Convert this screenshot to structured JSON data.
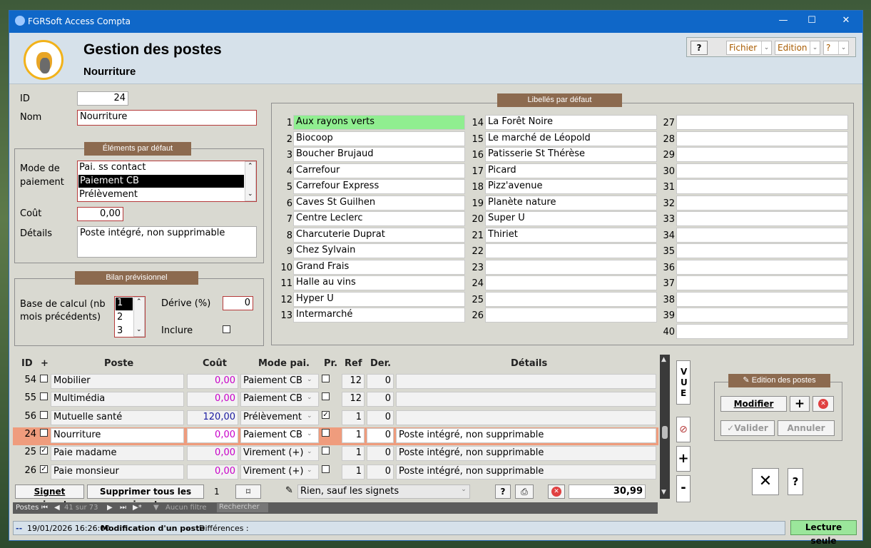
{
  "window": {
    "title": "FGRSoft Access Compta",
    "minimize": "—",
    "maximize": "☐",
    "close": "✕"
  },
  "header": {
    "title": "Gestion des postes",
    "subtitle": "Nourriture"
  },
  "menu": {
    "help": "?",
    "fichier": "Fichier",
    "edition": "Edition",
    "qmark": "?"
  },
  "form": {
    "id_label": "ID",
    "id_value": "24",
    "nom_label": "Nom",
    "nom_value": "Nourriture",
    "defaults_title": "Éléments par défaut",
    "mode_label": "Mode de paiement",
    "mode_options": [
      "Pai. ss contact",
      "Paiement CB",
      "Prélèvement"
    ],
    "mode_selected": "Paiement CB",
    "cout_label": "Coût",
    "cout_value": "0,00",
    "details_label": "Détails",
    "details_value": "Poste intégré, non supprimable",
    "bilan_title": "Bilan prévisionnel",
    "base_label": "Base de calcul (nb mois précédents)",
    "base_options": [
      "1",
      "2",
      "3"
    ],
    "derive_label": "Dérive (%)",
    "derive_value": "0",
    "inclure_label": "Inclure"
  },
  "libelles": {
    "title": "Libellés par défaut",
    "col1": [
      "Aux rayons verts",
      "Biocoop",
      "Boucher Brujaud",
      "Carrefour",
      "Carrefour Express",
      "Caves St Guilhen",
      "Centre Leclerc",
      "Charcuterie Duprat",
      "Chez Sylvain",
      "Grand Frais",
      "Halle au vins",
      "Hyper U",
      "Intermarché"
    ],
    "col2": [
      "La Forêt Noire",
      "Le marché de Léopold",
      "Patisserie St Thérèse",
      "Picard",
      "Pizz'avenue",
      "Planète nature",
      "Super U",
      "Thiriet",
      "",
      "",
      "",
      "",
      ""
    ],
    "col3_count": 14
  },
  "grid": {
    "headers": {
      "id": "ID",
      "plus": "+",
      "poste": "Poste",
      "cout": "Coût",
      "mode": "Mode pai.",
      "pr": "Pr.",
      "ref": "Ref",
      "der": "Der.",
      "details": "Détails"
    },
    "rows": [
      {
        "id": "54",
        "poste": "Mobilier",
        "cout": "0,00",
        "mode": "Paiement CB",
        "pr": "",
        "ref": "12",
        "der": "0",
        "details": "",
        "plus": ""
      },
      {
        "id": "55",
        "poste": "Multimédia",
        "cout": "0,00",
        "mode": "Paiement CB",
        "pr": "",
        "ref": "12",
        "der": "0",
        "details": "",
        "plus": ""
      },
      {
        "id": "56",
        "poste": "Mutuelle santé",
        "cout": "120,00",
        "mode": "Prélèvement",
        "pr": "✓",
        "ref": "1",
        "der": "0",
        "details": "",
        "plus": ""
      },
      {
        "id": "24",
        "poste": "Nourriture",
        "cout": "0,00",
        "mode": "Paiement CB",
        "pr": "",
        "ref": "1",
        "der": "0",
        "details": "Poste intégré, non supprimable",
        "plus": ""
      },
      {
        "id": "25",
        "poste": "Paie madame",
        "cout": "0,00",
        "mode": "Virement (+)",
        "pr": "",
        "ref": "1",
        "der": "0",
        "details": "Poste intégré, non supprimable",
        "plus": "✓"
      },
      {
        "id": "26",
        "poste": "Paie monsieur",
        "cout": "0,00",
        "mode": "Virement (+)",
        "pr": "",
        "ref": "1",
        "der": "0",
        "details": "Poste intégré, non supprimable",
        "plus": "✓"
      }
    ]
  },
  "bottom": {
    "signet_suivant": "Signet suivant",
    "supprimer_signets": "Supprimer tous les signets",
    "count": "1",
    "filter": "Rien, sauf les signets",
    "help": "?",
    "total": "30,99"
  },
  "nav": {
    "label": "Postes",
    "record": "41 sur 73",
    "nofilter": "Aucun filtre",
    "search": "Rechercher"
  },
  "side": {
    "vue": "VUE",
    "plus": "+",
    "minus": "-",
    "edition_title": "Edition des postes",
    "modifier": "Modifier",
    "valider": "Valider",
    "annuler": "Annuler",
    "close": "✕",
    "help": "?"
  },
  "status": {
    "prefix": "--",
    "datetime": "19/01/2026 16:26:00",
    "message": "Modification d'un poste",
    "diff": "Différences :",
    "readonly": "Lecture seule"
  },
  "colors": {
    "accent_blue": "#0f67c8",
    "group_header": "#8c6a4f",
    "selected_row": "#ef9c7d",
    "highlight_green": "#90ee90",
    "cost_magenta": "#c800c8",
    "cost_blue": "#1a1aa0",
    "readonly_green": "#9be69b"
  }
}
